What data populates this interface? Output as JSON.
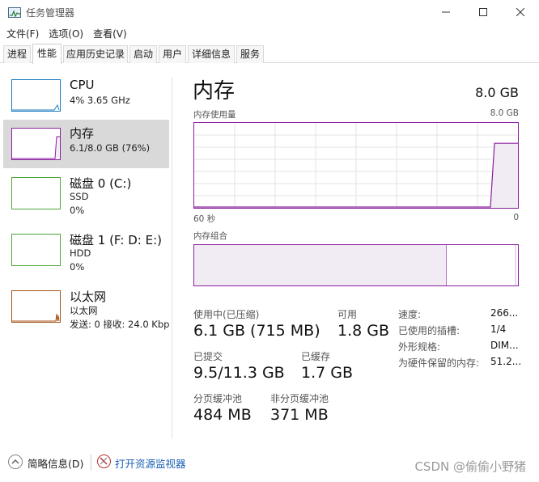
{
  "window": {
    "title": "任务管理器"
  },
  "menu": [
    "文件(F)",
    "选项(O)",
    "查看(V)"
  ],
  "tabs": [
    "进程",
    "性能",
    "应用历史记录",
    "启动",
    "用户",
    "详细信息",
    "服务"
  ],
  "active_tab": "性能",
  "resources": [
    {
      "name": "CPU",
      "sub1": "4% 3.65 GHz",
      "sub2": "",
      "color": "#1b7ac0"
    },
    {
      "name": "内存",
      "sub1": "6.1/8.0 GB (76%)",
      "sub2": "",
      "color": "#8b1e9e"
    },
    {
      "name": "磁盘 0 (C:)",
      "sub1": "SSD",
      "sub2": "0%",
      "color": "#4ca636"
    },
    {
      "name": "磁盘 1 (F: D: E:)",
      "sub1": "HDD",
      "sub2": "0%",
      "color": "#4ca636"
    },
    {
      "name": "以太网",
      "sub1": "以太网",
      "sub2": "发送: 0 接收: 24.0 Kbp",
      "color": "#a55217"
    }
  ],
  "memory": {
    "title": "内存",
    "total": "8.0 GB",
    "usage_graph": {
      "label": "内存使用量",
      "max": "8.0 GB",
      "time_left": "60 秒",
      "time_right": "0",
      "current_fraction": 0.76
    },
    "composition": {
      "label": "内存组合",
      "in_use_fraction": 0.78
    },
    "stats": {
      "in_use_label": "使用中(已压缩)",
      "in_use_value": "6.1 GB (715 MB)",
      "available_label": "可用",
      "available_value": "1.8 GB",
      "committed_label": "已提交",
      "committed_value": "9.5/11.3 GB",
      "cached_label": "已缓存",
      "cached_value": "1.7 GB",
      "paged_label": "分页缓冲池",
      "paged_value": "484 MB",
      "nonpaged_label": "非分页缓冲池",
      "nonpaged_value": "371 MB"
    },
    "props": [
      {
        "label": "速度:",
        "value": "266..."
      },
      {
        "label": "已使用的插槽:",
        "value": "1/4"
      },
      {
        "label": "外形规格:",
        "value": "DIM..."
      },
      {
        "label": "为硬件保留的内存:",
        "value": "51.2..."
      }
    ]
  },
  "bottom": {
    "summary": "简略信息(D)",
    "monitor": "打开资源监视器",
    "watermark": "CSDN @偷偷小野猪"
  },
  "colors": {
    "memory": "#8b1e9e",
    "cpu": "#1b7ac0",
    "disk": "#4ca636",
    "ethernet": "#a55217",
    "link": "#1a5fb4"
  }
}
